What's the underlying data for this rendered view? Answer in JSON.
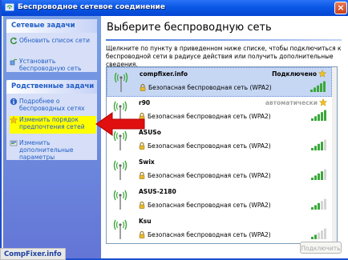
{
  "window": {
    "title": "Беспроводное сетевое соединение",
    "close_label": "×"
  },
  "sidebar": {
    "network_tasks": {
      "heading": "Сетевые задачи",
      "items": [
        {
          "label": "Обновить список сети",
          "icon": "refresh-icon"
        },
        {
          "label": "Установить беспроводную сеть",
          "icon": "setup-network-icon"
        }
      ]
    },
    "related_tasks": {
      "heading": "Родственные задачи",
      "items": [
        {
          "label": "Подробнее о беспроводных сетях",
          "icon": "info-icon"
        },
        {
          "label": "Изменить порядок предпочтения сетей",
          "icon": "star-icon",
          "highlighted": true
        },
        {
          "label": "Изменить дополнительные параметры",
          "icon": "settings-icon"
        }
      ]
    }
  },
  "main": {
    "title": "Выберите беспроводную сеть",
    "description": "Щелкните по пункту в приведенном ниже списке, чтобы подключиться к беспроводной сети в радиусе действия или получить дополнительные сведения.",
    "connect_button": "Подключить"
  },
  "networks": [
    {
      "name": "compfixer.info",
      "status": "Подключено",
      "status_kind": "connected",
      "starred": true,
      "security": "Безопасная беспроводная сеть (WPA2)",
      "signal": 5,
      "selected": true
    },
    {
      "name": "r90",
      "status": "Автоматически",
      "status_kind": "auto",
      "starred": true,
      "security": "Безопасная беспроводная сеть (WPA2)",
      "signal": 5,
      "selected": false
    },
    {
      "name": "ASUSo",
      "status": "",
      "status_kind": "",
      "starred": false,
      "security": "Безопасная беспроводная сеть (WPA2)",
      "signal": 4,
      "selected": false
    },
    {
      "name": "Swix",
      "status": "",
      "status_kind": "",
      "starred": false,
      "security": "Безопасная беспроводная сеть (WPA2)",
      "signal": 4,
      "selected": false
    },
    {
      "name": "ASUS-2180",
      "status": "",
      "status_kind": "",
      "starred": false,
      "security": "Безопасная беспроводная сеть (WPA2)",
      "signal": 3,
      "selected": false
    },
    {
      "name": "Ksu",
      "status": "",
      "status_kind": "",
      "starred": false,
      "security": "Безопасная беспроводная сеть (WPA2)",
      "signal": 2,
      "selected": false
    }
  ],
  "watermark": "CompFixer.info",
  "colors": {
    "titlebar": "#0a58e6",
    "highlight": "#ffff00",
    "arrow": "#e01010",
    "signal_on": "#3aa83a",
    "signal_off": "#d4d4d4"
  }
}
